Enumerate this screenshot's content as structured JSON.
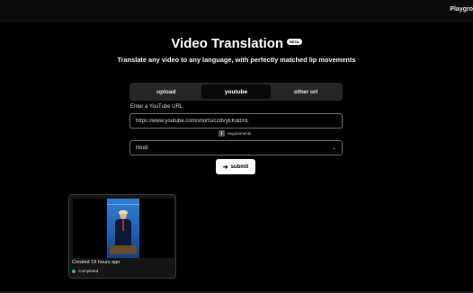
{
  "header": {
    "brand": "Playgro"
  },
  "hero": {
    "title": "Video Translation",
    "badge": "BETA",
    "subtitle": "Translate any video to any language, with perfectly matched lip movements"
  },
  "tabs": [
    {
      "label": "upload",
      "active": false
    },
    {
      "label": "youtube",
      "active": true
    },
    {
      "label": "other url",
      "active": false
    }
  ],
  "form": {
    "url_label": "Enter a YouTube URL",
    "url_value": "https://www.youtube.com/shorts/c2dVyEKddXE",
    "requirements_label": "requirements",
    "requirements_icon": "info-icon",
    "language_value": "Hindi",
    "submit_label": "submit",
    "submit_icon": "arrow-right-icon"
  },
  "results": [
    {
      "created": "Created 19 hours ago",
      "status": "Completed",
      "status_color": "#22c55e"
    }
  ]
}
